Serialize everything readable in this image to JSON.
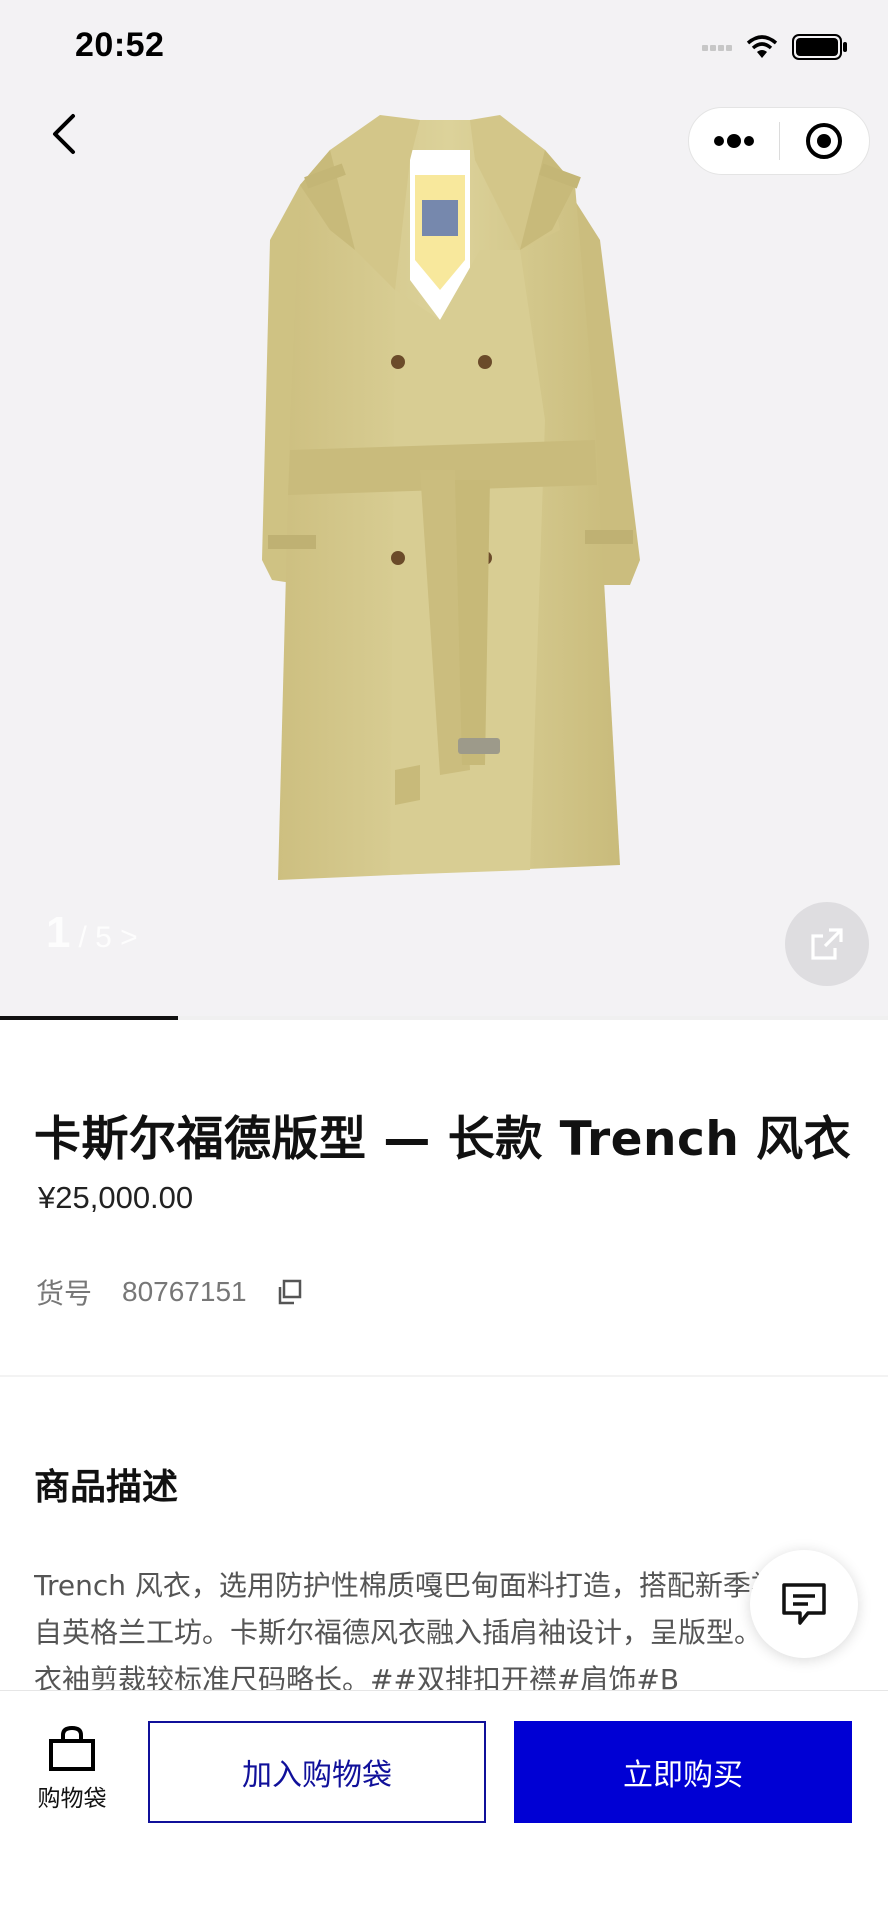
{
  "status_bar": {
    "time": "20:52"
  },
  "header": {
    "back_icon": "chevron-left-icon",
    "more_icon": "more-dots-icon",
    "close_icon": "target-circle-icon"
  },
  "gallery": {
    "current": "1",
    "total_label": "/ 5 >",
    "share_icon": "share-out-icon",
    "progress": 0.2
  },
  "product": {
    "title": "卡斯尔福德版型 — 长款 Trench 风衣",
    "price": "¥25,000.00",
    "sku_label": "货号",
    "sku_value": "80767151"
  },
  "description": {
    "heading": "商品描述",
    "body": "Trench 风衣，选用防护性棉质嘎巴甸面料打造，搭配新季衬，产自英格兰工坊。卡斯尔福德风衣融入插肩袖设计，呈版型。衣摆与衣袖剪裁较标准尺码略长。##双排扣开襟#肩饰#B"
  },
  "bottom_bar": {
    "bag_label": "购物袋",
    "add_to_bag": "加入购物袋",
    "buy_now": "立即购买"
  },
  "colors": {
    "accent": "#0000d4",
    "coat": "#d7cc8f"
  }
}
